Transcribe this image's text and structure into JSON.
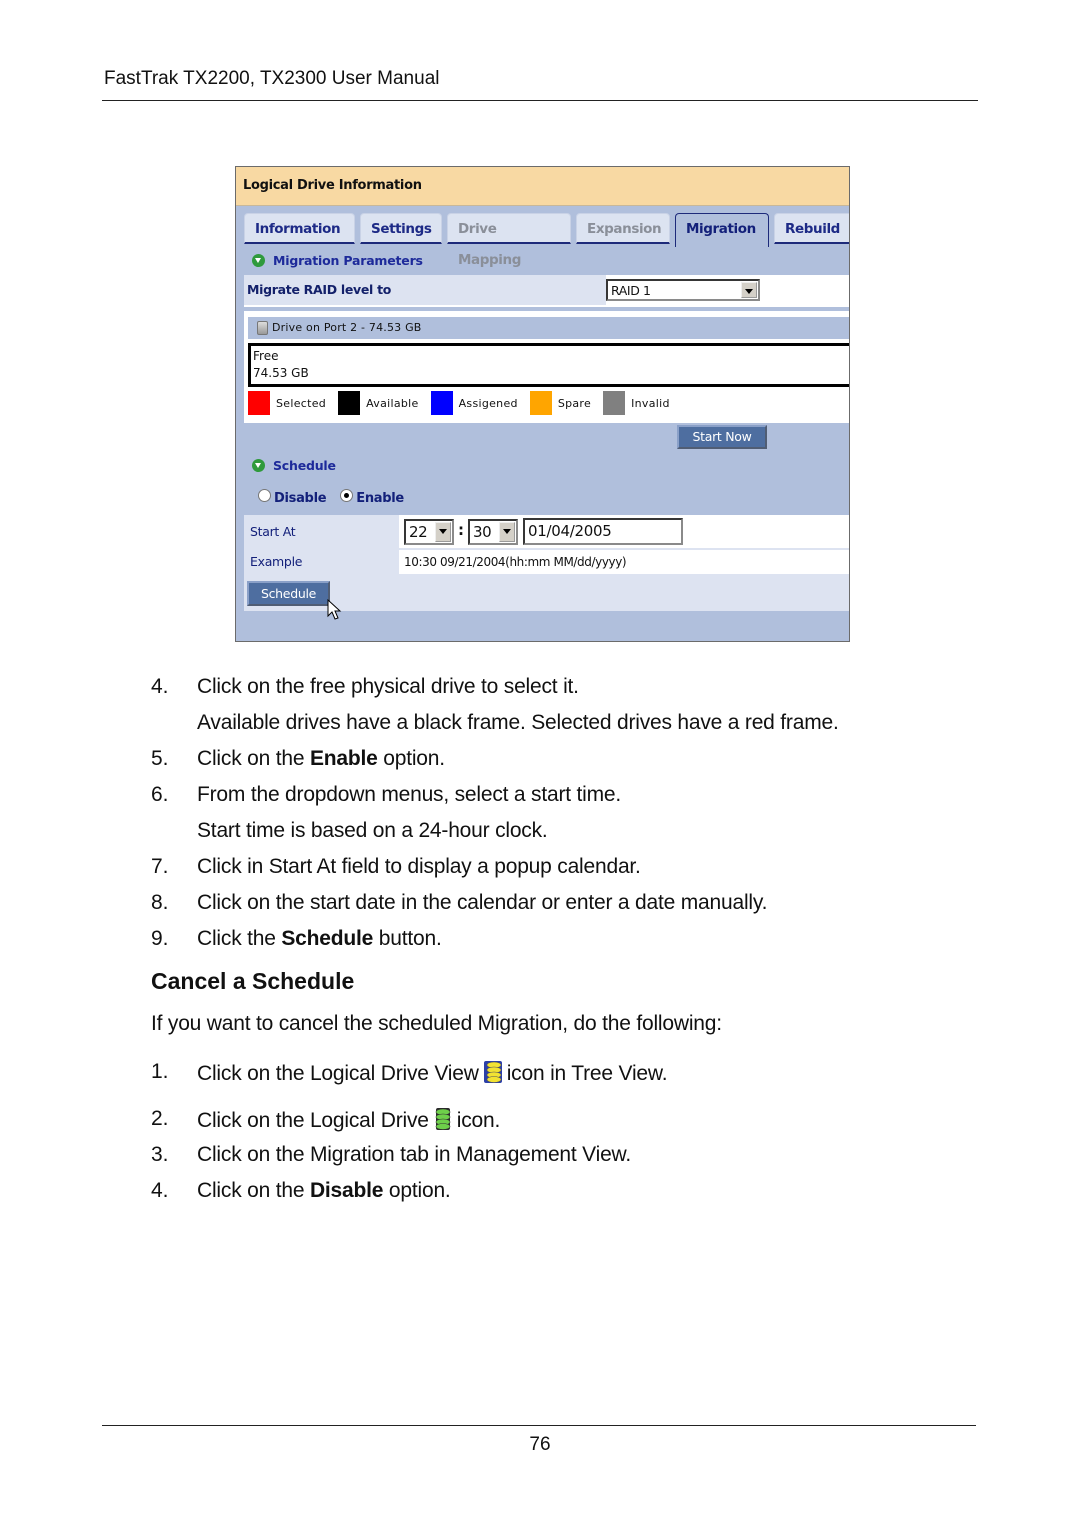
{
  "header": {
    "title": "FastTrak TX2200, TX2300 User Manual"
  },
  "footer": {
    "page_number": "76"
  },
  "screenshot": {
    "panel_title": "Logical Drive Information",
    "tabs": [
      {
        "label": "Information",
        "state": "enabled"
      },
      {
        "label": "Settings",
        "state": "enabled"
      },
      {
        "label": "Drive Mapping",
        "state": "disabled"
      },
      {
        "label": "Expansion",
        "state": "disabled"
      },
      {
        "label": "Migration",
        "state": "active"
      },
      {
        "label": "Rebuild",
        "state": "enabled"
      }
    ],
    "migration_section": "Migration Parameters",
    "raid_label": "Migrate RAID level to",
    "raid_value": "RAID 1",
    "drive_header": "Drive on Port 2 - 74.53 GB",
    "drive_status": "Free",
    "drive_size": "74.53 GB",
    "legend": [
      {
        "label": "Selected",
        "color": "#ff0000"
      },
      {
        "label": "Available",
        "color": "#000000"
      },
      {
        "label": "Assigened",
        "color": "#0000ff"
      },
      {
        "label": "Spare",
        "color": "#ffa500"
      },
      {
        "label": "Invalid",
        "color": "#808080"
      }
    ],
    "start_now_label": "Start Now",
    "schedule_section": "Schedule",
    "radio_disable": "Disable",
    "radio_enable": "Enable",
    "selected_radio": "Enable",
    "start_at_label": "Start At",
    "hour_value": "22",
    "colon": ":",
    "minute_value": "30",
    "date_value": "01/04/2005",
    "example_label": "Example",
    "example_value": "10:30 09/21/2004(hh:mm MM/dd/yyyy)",
    "schedule_button": "Schedule"
  },
  "steps": [
    {
      "num": "4.",
      "text": "Click on the free physical drive to select it."
    },
    {
      "num": "",
      "text": "Available drives have a black frame. Selected drives have a red frame."
    },
    {
      "num": "5.",
      "pre": "Click on the ",
      "bold": "Enable",
      "post": " option."
    },
    {
      "num": "6.",
      "text": "From the dropdown menus, select a start time."
    },
    {
      "num": "",
      "text": "Start time is based on a 24-hour clock."
    },
    {
      "num": "7.",
      "text": "Click in Start At field to display a popup calendar."
    },
    {
      "num": "8.",
      "text": "Click on the start date in the calendar or enter a date manually."
    },
    {
      "num": "9.",
      "pre": "Click the ",
      "bold": "Schedule",
      "post": " button."
    }
  ],
  "cancel": {
    "heading": "Cancel a Schedule",
    "intro": "If you want to cancel the scheduled Migration, do the following:",
    "steps": [
      {
        "num": "1.",
        "pre": "Click on the Logical Drive View",
        "icon": "logical-drive-view-icon",
        "post": "icon in Tree View."
      },
      {
        "num": "2.",
        "pre": "Click on the Logical Drive",
        "icon": "logical-drive-icon",
        "post": "icon."
      },
      {
        "num": "3.",
        "text": "Click on the Migration tab in Management View."
      },
      {
        "num": "4.",
        "pre": "Click on the ",
        "bold": "Disable",
        "post": " option."
      }
    ]
  }
}
